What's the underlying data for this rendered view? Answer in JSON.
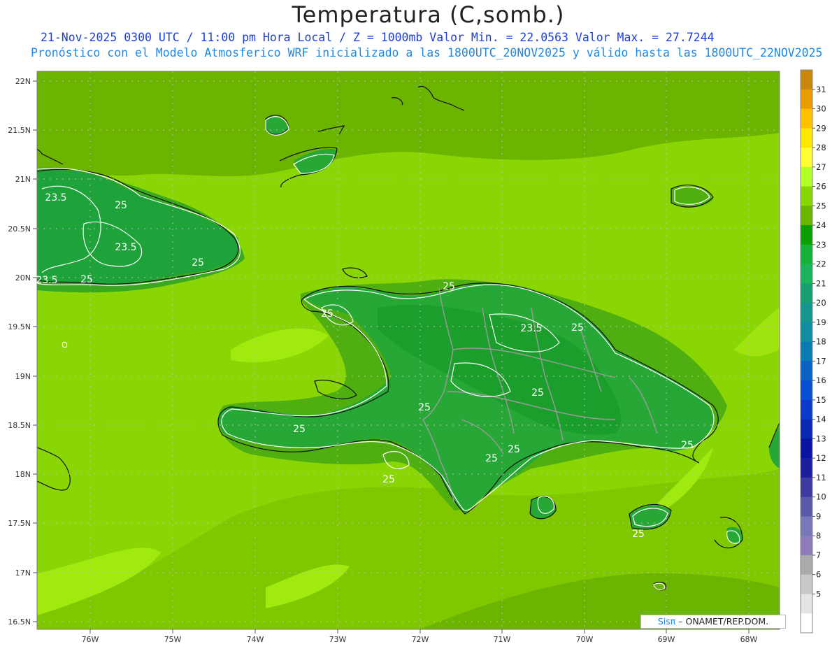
{
  "header": {
    "title": "Temperatura (C,somb.)",
    "subtitle_1": "21-Nov-2025 0300 UTC / 11:00 pm Hora Local / Z = 1000mb  Valor Min. = 22.0563  Valor Max. = 27.7244",
    "subtitle_2": "Pronóstico con el Modelo Atmosferico WRF inicializado a las 1800UTC_20NOV2025 y válido hasta las  1800UTC_22NOV2025"
  },
  "map": {
    "lat_labels": [
      "22N",
      "21.5N",
      "21N",
      "20.5N",
      "20N",
      "19.5N",
      "19N",
      "18.5N",
      "18N",
      "17.5N",
      "17N",
      "16.5N"
    ],
    "lon_labels": [
      "76W",
      "75W",
      "74W",
      "73W",
      "72W",
      "71W",
      "70W",
      "69W",
      "68W"
    ],
    "contour_labels": [
      "23.5",
      "25",
      "23.5",
      "25",
      "23.5",
      "25",
      "25",
      "25",
      "23.5",
      "25",
      "25",
      "25",
      "25",
      "25",
      "25",
      "25",
      "25",
      "25"
    ]
  },
  "colorbar": {
    "levels": [
      "31",
      "30",
      "29",
      "28",
      "27",
      "26",
      "25",
      "24",
      "23",
      "22",
      "21",
      "20",
      "19",
      "18",
      "17",
      "16",
      "15",
      "14",
      "13",
      "12",
      "11",
      "10",
      "9",
      "8",
      "7",
      "6",
      "5"
    ],
    "colors": [
      "#c8860a",
      "#e89c00",
      "#ffc000",
      "#ffe800",
      "#ffff33",
      "#b4ff2a",
      "#8ad604",
      "#6bb400",
      "#0aa000",
      "#14b43c",
      "#1ab45a",
      "#1aa070",
      "#16968c",
      "#0e8ea0",
      "#0a7cb4",
      "#0a64c8",
      "#0a4ed2",
      "#0a3cc8",
      "#0a28b4",
      "#0a14a0",
      "#1e1e9c",
      "#3c3ca0",
      "#5a5aaa",
      "#7878b8",
      "#8c7cb8",
      "#aaaaaa",
      "#c8c8c8",
      "#e4e4e4",
      "#ffffff"
    ]
  },
  "credit": {
    "brand": "Sisπ",
    "text": " – ONAMET/REP.DOM."
  }
}
